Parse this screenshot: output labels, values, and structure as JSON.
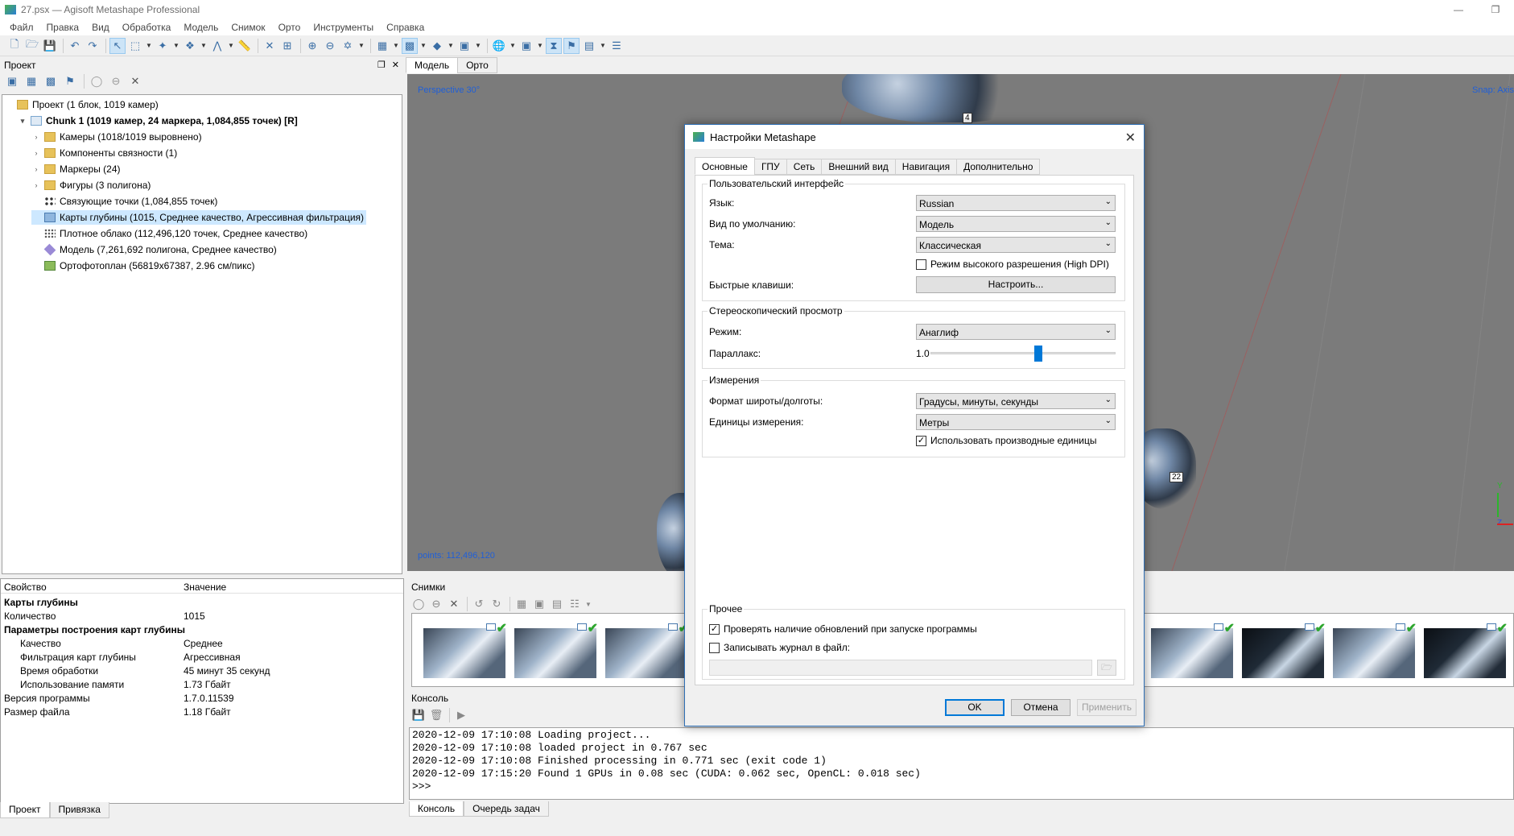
{
  "window": {
    "title": "27.psx — Agisoft Metashape Professional"
  },
  "menu": [
    "Файл",
    "Правка",
    "Вид",
    "Обработка",
    "Модель",
    "Снимок",
    "Орто",
    "Инструменты",
    "Справка"
  ],
  "project_panel": {
    "title": "Проект",
    "tree": [
      {
        "label": "Проект (1 блок, 1019 камер)",
        "icon": "project-icon",
        "indent": 0,
        "arrow": ""
      },
      {
        "label": "Chunk 1 (1019 камер, 24 маркера, 1,084,855 точек) [R]",
        "icon": "chunk-icon",
        "indent": 1,
        "arrow": "▾",
        "bold": true
      },
      {
        "label": "Камеры (1018/1019 выровнено)",
        "icon": "folder-icon",
        "indent": 2,
        "arrow": "›"
      },
      {
        "label": "Компоненты связности (1)",
        "icon": "folder-icon",
        "indent": 2,
        "arrow": "›"
      },
      {
        "label": "Маркеры (24)",
        "icon": "folder-icon",
        "indent": 2,
        "arrow": "›"
      },
      {
        "label": "Фигуры (3 полигона)",
        "icon": "folder-icon",
        "indent": 2,
        "arrow": "›"
      },
      {
        "label": "Связующие точки (1,084,855 точек)",
        "icon": "tie-points-icon",
        "indent": 2,
        "arrow": ""
      },
      {
        "label": "Карты глубины (1015, Среднее качество, Агрессивная фильтрация)",
        "icon": "depth-maps-icon",
        "indent": 2,
        "arrow": "",
        "selected": true
      },
      {
        "label": "Плотное облако (112,496,120 точек, Среднее качество)",
        "icon": "dense-cloud-icon",
        "indent": 2,
        "arrow": ""
      },
      {
        "label": "Модель (7,261,692 полигона, Среднее качество)",
        "icon": "model-icon",
        "indent": 2,
        "arrow": ""
      },
      {
        "label": "Ортофотоплан (56819x67387, 2.96 см/пикс)",
        "icon": "orthomosaic-icon",
        "indent": 2,
        "arrow": ""
      }
    ]
  },
  "properties": {
    "col_property": "Свойство",
    "col_value": "Значение",
    "rows": [
      {
        "name": "Карты глубины",
        "value": "",
        "bold": true,
        "indent": 0
      },
      {
        "name": "Количество",
        "value": "1015",
        "indent": 0
      },
      {
        "name": "Параметры построения карт глубины",
        "value": "",
        "bold": true,
        "indent": 0
      },
      {
        "name": "Качество",
        "value": "Среднее",
        "indent": 1
      },
      {
        "name": "Фильтрация карт глубины",
        "value": "Агрессивная",
        "indent": 1
      },
      {
        "name": "Время обработки",
        "value": "45 минут 35 секунд",
        "indent": 1
      },
      {
        "name": "Использование памяти",
        "value": "1.73 Гбайт",
        "indent": 1
      },
      {
        "name": "Версия программы",
        "value": "1.7.0.11539",
        "indent": 0
      },
      {
        "name": "Размер файла",
        "value": "1.18 Гбайт",
        "indent": 0
      }
    ]
  },
  "left_bottom_tabs": [
    "Проект",
    "Привязка"
  ],
  "view_tabs": [
    "Модель",
    "Орто"
  ],
  "viewport": {
    "perspective": "Perspective 30°",
    "snap": "Snap: Axis",
    "points": "points: 112,496,120",
    "marker_a": "4",
    "marker_b": "22",
    "axis_y": "Y",
    "axis_z": "Z"
  },
  "photos_panel": {
    "title": "Снимки",
    "thumbs": 12
  },
  "console_panel": {
    "title": "Консоль",
    "lines": [
      "2020-12-09 17:10:08 Loading project...",
      "2020-12-09 17:10:08 loaded project in 0.767 sec",
      "2020-12-09 17:10:08 Finished processing in 0.771 sec (exit code 1)",
      "2020-12-09 17:15:20 Found 1 GPUs in 0.08 sec (CUDA: 0.062 sec, OpenCL: 0.018 sec)",
      ">>>"
    ],
    "tabs": [
      "Консоль",
      "Очередь задач"
    ]
  },
  "dialog": {
    "title": "Настройки Metashape",
    "tabs": [
      "Основные",
      "ГПУ",
      "Сеть",
      "Внешний вид",
      "Навигация",
      "Дополнительно"
    ],
    "ui_group": "Пользовательский интерфейс",
    "language_label": "Язык:",
    "language_value": "Russian",
    "default_view_label": "Вид по умолчанию:",
    "default_view_value": "Модель",
    "theme_label": "Тема:",
    "theme_value": "Классическая",
    "high_dpi_label": "Режим высокого разрешения (High DPI)",
    "high_dpi_checked": false,
    "shortcuts_label": "Быстрые клавиши:",
    "shortcuts_button": "Настроить...",
    "stereo_group": "Стереоскопический просмотр",
    "mode_label": "Режим:",
    "mode_value": "Анаглиф",
    "parallax_label": "Параллакс:",
    "parallax_value": "1.0",
    "parallax_fraction": 0.5,
    "measure_group": "Измерения",
    "latlon_label": "Формат широты/долготы:",
    "latlon_value": "Градусы, минуты, секунды",
    "units_label": "Единицы измерения:",
    "units_value": "Метры",
    "derived_units_label": "Использовать производные единицы",
    "derived_units_checked": true,
    "misc_group": "Прочее",
    "check_updates_label": "Проверять наличие обновлений при запуске программы",
    "check_updates_checked": true,
    "log_label": "Записывать журнал в файл:",
    "log_checked": false,
    "ok": "OK",
    "cancel": "Отмена",
    "apply": "Применить"
  },
  "colors": {
    "accent": "#0078d7",
    "viewport": "#7b7b7b",
    "viewport_label": "#1f5fd8",
    "selection": "#cde8ff"
  }
}
